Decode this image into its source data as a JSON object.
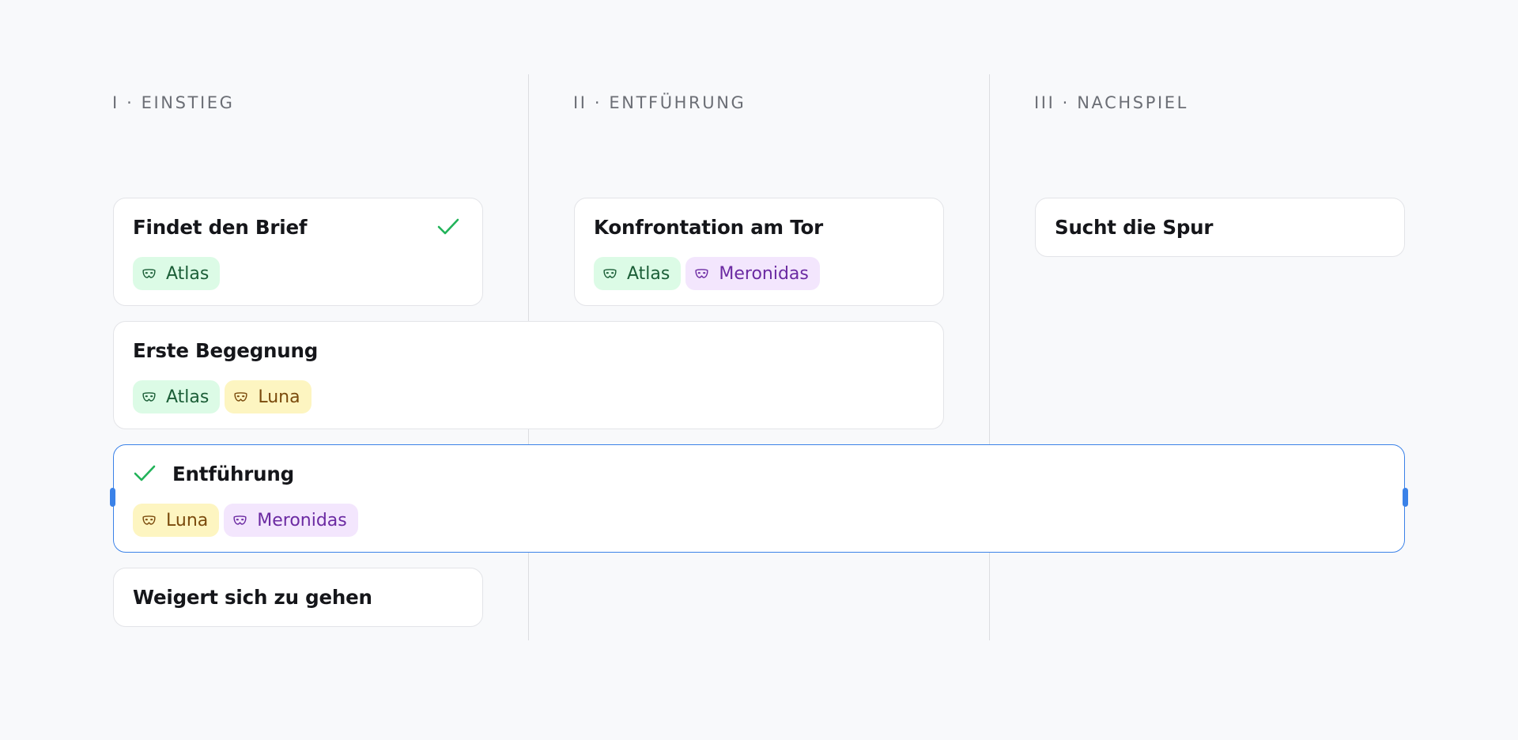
{
  "columns": [
    {
      "label": "I · EINSTIEG"
    },
    {
      "label": "II · ENTFÜHRUNG"
    },
    {
      "label": "III · NACHSPIEL"
    }
  ],
  "colors": {
    "accent": "#3b82e8",
    "check": "#22b35a",
    "atlas_bg": "#dcfbe6",
    "luna_bg": "#fdf5c1",
    "meronidas_bg": "#f3e6fd"
  },
  "cards": {
    "findet_den_brief": {
      "title": "Findet den Brief",
      "done": true,
      "tags": [
        "Atlas"
      ]
    },
    "konfrontation": {
      "title": "Konfrontation am Tor",
      "tags": [
        "Atlas",
        "Meronidas"
      ]
    },
    "sucht_die_spur": {
      "title": "Sucht die Spur",
      "tags": []
    },
    "erste_begegnung": {
      "title": "Erste Begegnung",
      "tags": [
        "Atlas",
        "Luna"
      ]
    },
    "entfuehrung": {
      "title": "Entführung",
      "done": true,
      "selected": true,
      "tags": [
        "Luna",
        "Meronidas"
      ]
    },
    "weigert_sich": {
      "title": "Weigert sich zu gehen",
      "tags": []
    }
  },
  "icons": {
    "done": "check-icon",
    "tag": "mask-icon",
    "resize": "resize-handle"
  }
}
